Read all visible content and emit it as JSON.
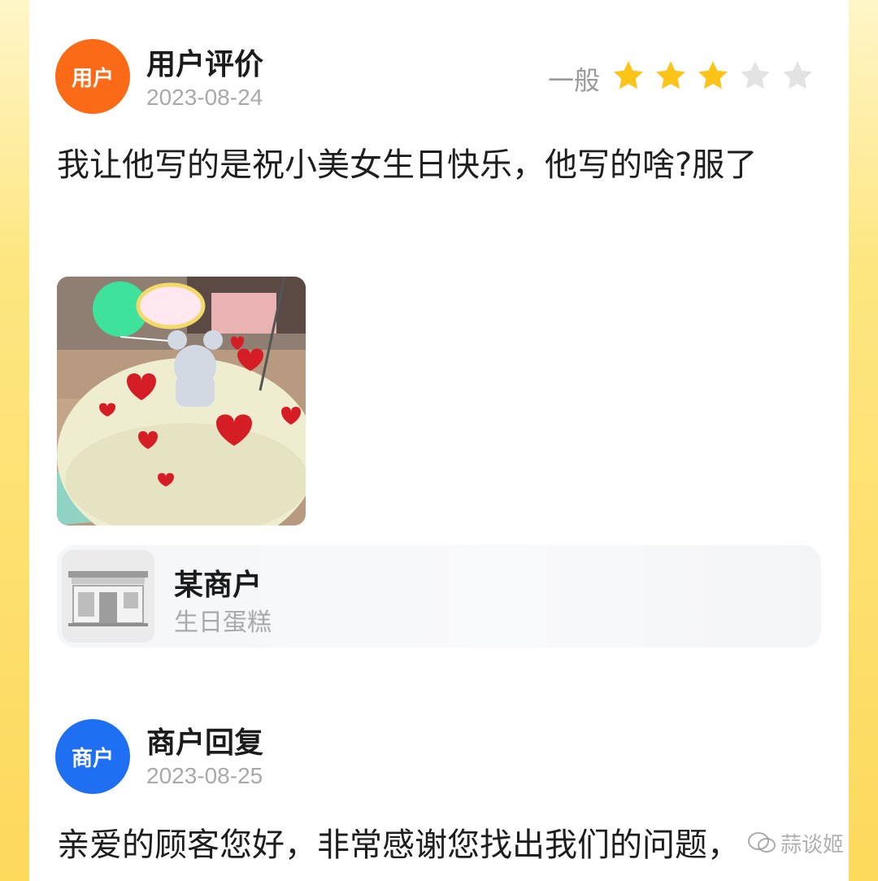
{
  "user_review": {
    "avatar_label": "用户",
    "title": "用户评价",
    "date": "2023-08-24",
    "rating_label": "一般",
    "rating_value": 3,
    "rating_max": 5,
    "text": "我让他写的是祝小美女生日快乐，他写的啥?服了",
    "photo_icon": "cake-photo"
  },
  "merchant_card": {
    "name": "某商户",
    "category": "生日蛋糕",
    "icon": "storefront-icon"
  },
  "merchant_reply": {
    "avatar_label": "商户",
    "title": "商户回复",
    "date": "2023-08-25",
    "text": "亲爱的顾客您好，非常感谢您找出我们的问题，"
  },
  "watermark": {
    "icon": "wechat-icon",
    "text": "蒜谈姬"
  },
  "colors": {
    "user_avatar": "#fb6a16",
    "shop_avatar": "#1f6ff2",
    "star_on": "#fcc419",
    "star_off": "#e3e3e3",
    "side_background": "#fde58a"
  }
}
